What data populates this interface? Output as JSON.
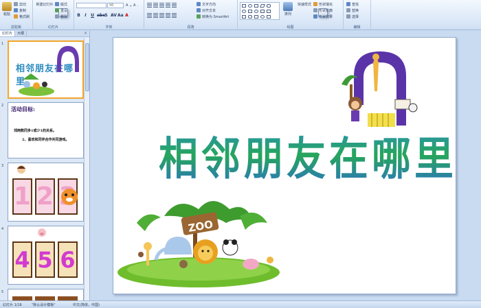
{
  "ribbon": {
    "clipboard": {
      "label": "剪贴板",
      "paste": "粘贴",
      "cut": "剪切",
      "copy": "复制",
      "format_painter": "格式刷"
    },
    "slides": {
      "label": "幻灯片",
      "new_slide": "新建幻灯片",
      "layout": "版式",
      "reset": "重设",
      "delete": "删除"
    },
    "font": {
      "label": "字体",
      "size": "96"
    },
    "paragraph": {
      "label": "段落",
      "text_direction": "文字方向",
      "align_text": "对齐文本",
      "smartart": "转换为 SmartArt"
    },
    "drawing": {
      "label": "绘图",
      "arrange": "排列",
      "quick_styles": "快速样式",
      "shape_fill": "形状填充",
      "shape_outline": "形状轮廓",
      "shape_effects": "形状效果"
    },
    "editing": {
      "label": "编辑",
      "find": "查找",
      "replace": "替换",
      "select": "选择"
    }
  },
  "panel": {
    "tabs": [
      "幻灯片",
      "大纲"
    ],
    "close": "×",
    "slides": [
      {
        "num": "1",
        "title": "相邻朋友在哪里"
      },
      {
        "num": "2",
        "heading": "活动目标:",
        "lines": [
          "邻两数同多1或少1的关系。",
          "2、喜欢和同伴合作共同游戏。"
        ]
      },
      {
        "num": "3",
        "digits": [
          "1",
          "2",
          "3"
        ]
      },
      {
        "num": "4",
        "digits": [
          "4",
          "5",
          "6"
        ]
      },
      {
        "num": "5"
      }
    ]
  },
  "slide": {
    "title": "相邻朋友在哪里",
    "zoo_sign": "ZOO"
  },
  "status": {
    "slide_pos": "幻灯片 1/16",
    "theme": "\"默认设计模板\"",
    "language": "中文(简体，中国)"
  },
  "colors": {
    "selection": "#f4a62a",
    "title_gradient_top": "#2b8ec4",
    "title_gradient_mid": "#26a65b"
  }
}
